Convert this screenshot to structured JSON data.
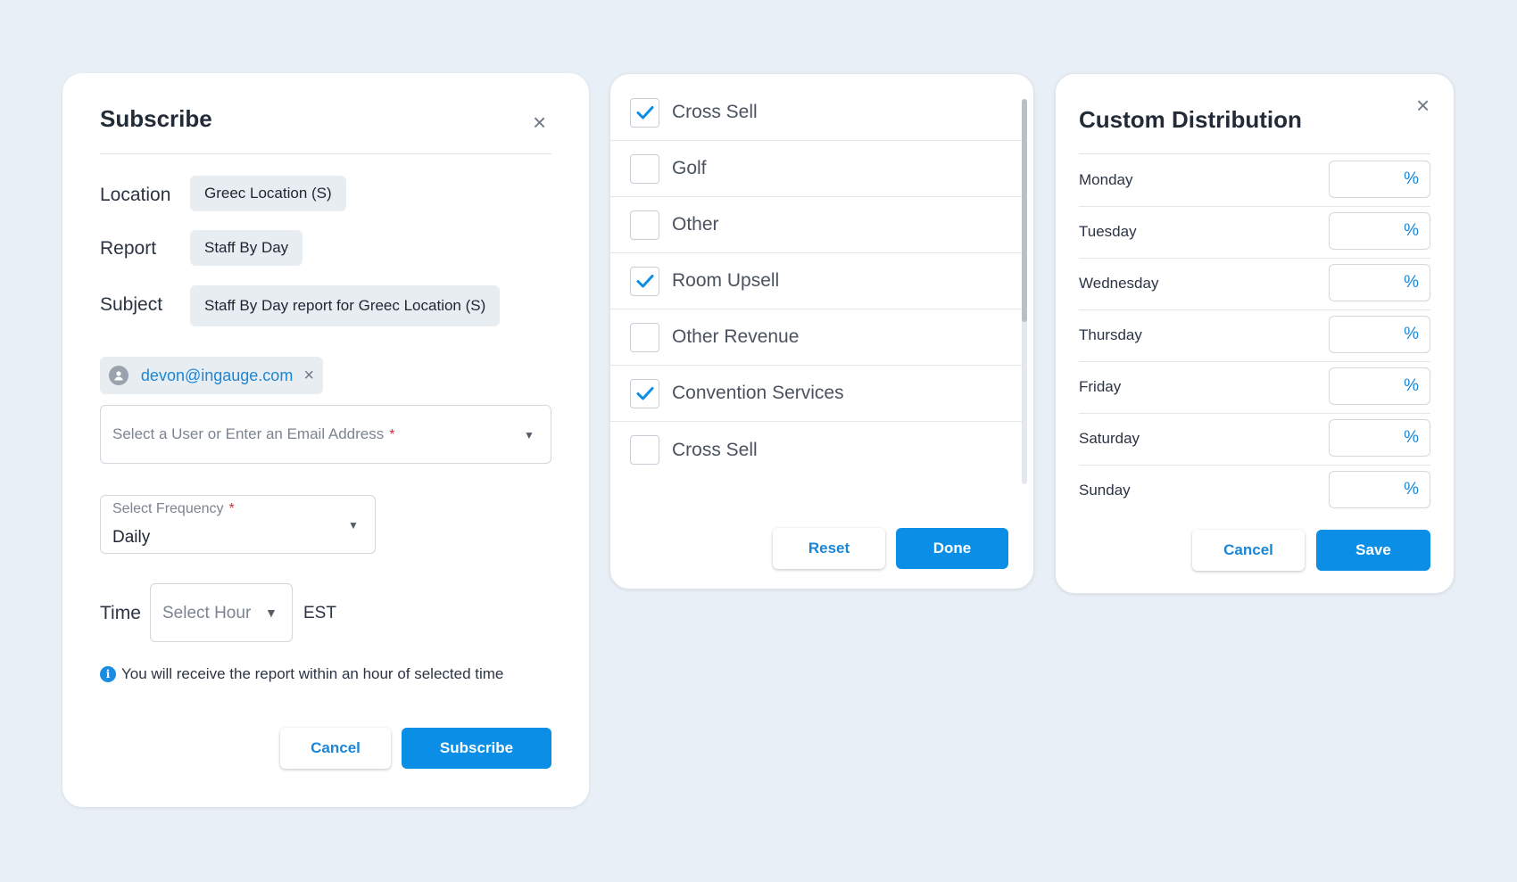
{
  "subscribe": {
    "title": "Subscribe",
    "close_label": "×",
    "location_label": "Location",
    "location_value": "Greec Location (S)",
    "report_label": "Report",
    "report_value": "Staff By Day",
    "subject_label": "Subject",
    "subject_value": "Staff By Day report for Greec Location (S)",
    "email_chip": "devon@ingauge.com",
    "chip_remove": "×",
    "user_placeholder": "Select a User or Enter an Email Address",
    "required_mark": "*",
    "frequency_label": "Select Frequency",
    "frequency_value": "Daily",
    "time_label": "Time",
    "hour_placeholder": "Select Hour",
    "timezone": "EST",
    "info_icon": "i",
    "info_text": "You will receive the report within an hour of selected time",
    "cancel_label": "Cancel",
    "subscribe_label": "Subscribe"
  },
  "checklist": {
    "items": [
      {
        "label": "Cross Sell",
        "checked": true
      },
      {
        "label": "Golf",
        "checked": false
      },
      {
        "label": "Other",
        "checked": false
      },
      {
        "label": "Room Upsell",
        "checked": true
      },
      {
        "label": "Other Revenue",
        "checked": false
      },
      {
        "label": "Convention Services",
        "checked": true
      },
      {
        "label": "Cross Sell",
        "checked": false
      }
    ],
    "reset_label": "Reset",
    "done_label": "Done"
  },
  "custom_distribution": {
    "title": "Custom Distribution",
    "close_label": "×",
    "percent_symbol": "%",
    "days": [
      "Monday",
      "Tuesday",
      "Wednesday",
      "Thursday",
      "Friday",
      "Saturday",
      "Sunday"
    ],
    "cancel_label": "Cancel",
    "save_label": "Save"
  },
  "colors": {
    "accent": "#0b8ee6",
    "link": "#1a86d6",
    "required": "#d6303a",
    "background": "#e8eff6"
  }
}
